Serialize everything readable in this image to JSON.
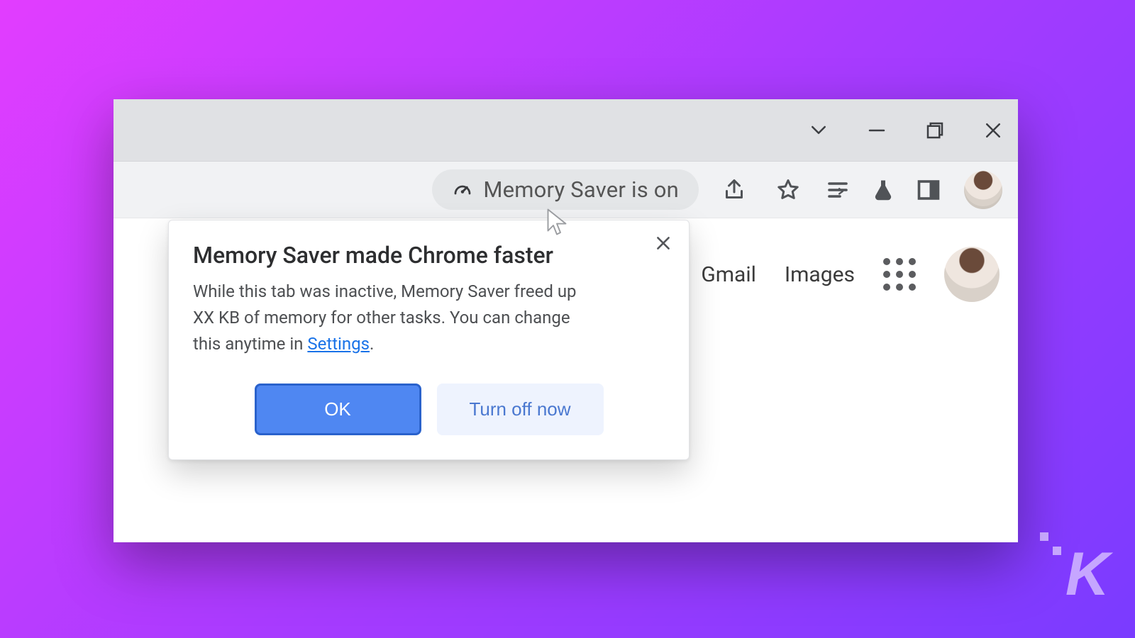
{
  "chip": {
    "label": "Memory Saver is on"
  },
  "page_nav": {
    "gmail": "Gmail",
    "images": "Images"
  },
  "dialog": {
    "title": "Memory Saver made Chrome faster",
    "body_pre": "While this tab was inactive, Memory Saver freed up XX KB of memory for other tasks. You can change this anytime in ",
    "settings_link": "Settings",
    "body_post": ".",
    "ok": "OK",
    "turn_off": "Turn off now"
  },
  "watermark": "K"
}
